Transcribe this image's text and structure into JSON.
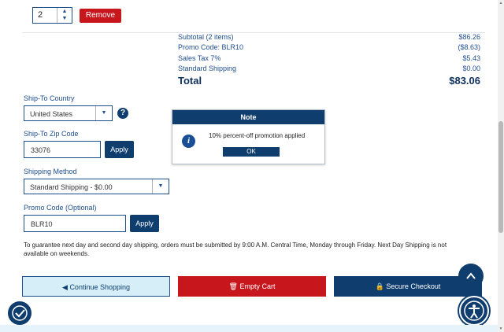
{
  "cart": {
    "quantity": "2",
    "remove_label": "Remove"
  },
  "summary": {
    "rows": [
      {
        "label": "Subtotal (2 items)",
        "value": "$86.26"
      },
      {
        "label": "Promo Code: BLR10",
        "value": "($8.63)"
      },
      {
        "label": "Sales Tax 7%",
        "value": "$5.43"
      },
      {
        "label": "Standard Shipping",
        "value": "$0.00"
      }
    ],
    "total_label": "Total",
    "total_value": "$83.06"
  },
  "form": {
    "country_label": "Ship-To Country",
    "country_value": "United States",
    "zip_label": "Ship-To Zip Code",
    "zip_value": "33076",
    "zip_apply": "Apply",
    "method_label": "Shipping Method",
    "method_value": "Standard Shipping - $0.00",
    "promo_label": "Promo Code (Optional)",
    "promo_value": "BLR10",
    "promo_apply": "Apply"
  },
  "note": {
    "title": "Note",
    "message": "10% percent-off promotion applied",
    "ok_label": "OK"
  },
  "info_text": "To guarantee next day and second day shipping, orders must be submitted by 9:00 A.M. Central Time, Monday through Friday. Next Day Shipping is not available on weekends.",
  "actions": {
    "continue_label": "Continue Shopping",
    "empty_label": "Empty Cart",
    "secure_label": "Secure Checkout"
  },
  "colors": {
    "primary": "#0e3d6e",
    "danger": "#c8161d",
    "light": "#d6eef7"
  }
}
